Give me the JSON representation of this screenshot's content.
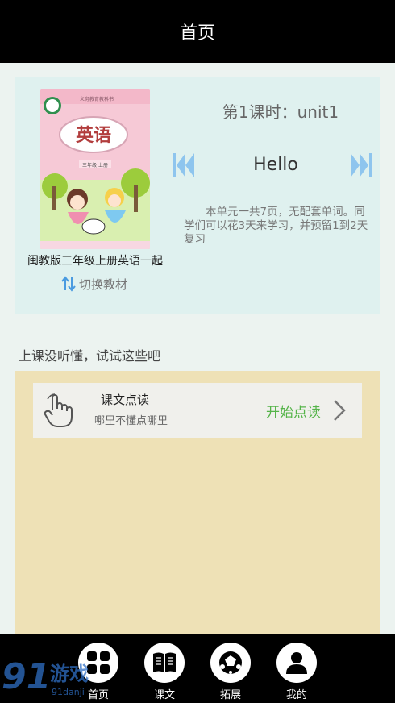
{
  "header": {
    "title": "首页"
  },
  "book": {
    "name": "闽教版三年级上册英语一起",
    "switch_label": "切换教材",
    "cover": {
      "badge": "义务教育教科书",
      "subject": "英语",
      "grade": "三年级 上册"
    }
  },
  "lesson": {
    "title": "第1课时：unit1",
    "name": "Hello",
    "description": "本单元一共7页，无配套单词。同学们可以花3天来学习，并预留1到2天复习"
  },
  "tips": {
    "heading": "上课没听懂，试试这些吧",
    "read_card": {
      "title": "课文点读",
      "subtitle": "哪里不懂点哪里",
      "action": "开始点读"
    }
  },
  "tabs": [
    {
      "label": "首页",
      "icon": "grid-icon"
    },
    {
      "label": "课文",
      "icon": "book-icon"
    },
    {
      "label": "拓展",
      "icon": "ball-icon"
    },
    {
      "label": "我的",
      "icon": "user-icon"
    }
  ],
  "watermark": {
    "text": "游戏",
    "sub": "91danji"
  },
  "colors": {
    "topbar": "#000000",
    "card": "#dff1ef",
    "panel": "#eee1b6",
    "accent_green": "#55b449",
    "arrow_blue": "#8ec5ee"
  }
}
